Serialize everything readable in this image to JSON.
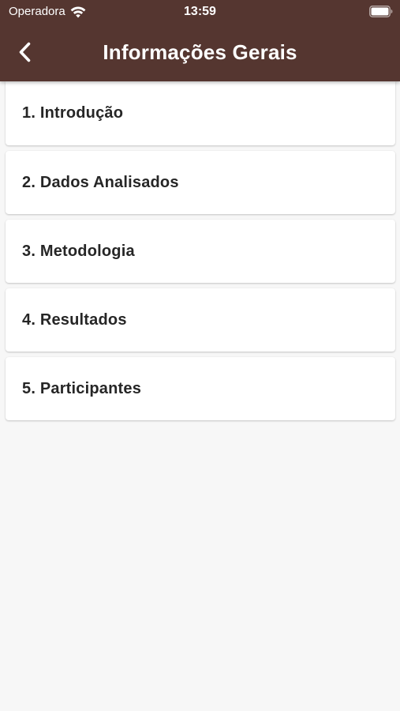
{
  "status_bar": {
    "carrier": "Operadora",
    "time": "13:59"
  },
  "header": {
    "title": "Informações Gerais",
    "back_icon": "chevron-left-icon"
  },
  "sections": [
    {
      "label": "1. Introdução"
    },
    {
      "label": "2. Dados Analisados"
    },
    {
      "label": "3. Metodologia"
    },
    {
      "label": "4. Resultados"
    },
    {
      "label": "5. Participantes"
    }
  ],
  "colors": {
    "app_bar": "#553630",
    "background": "#f7f7f7",
    "card": "#ffffff",
    "text": "#262626"
  }
}
